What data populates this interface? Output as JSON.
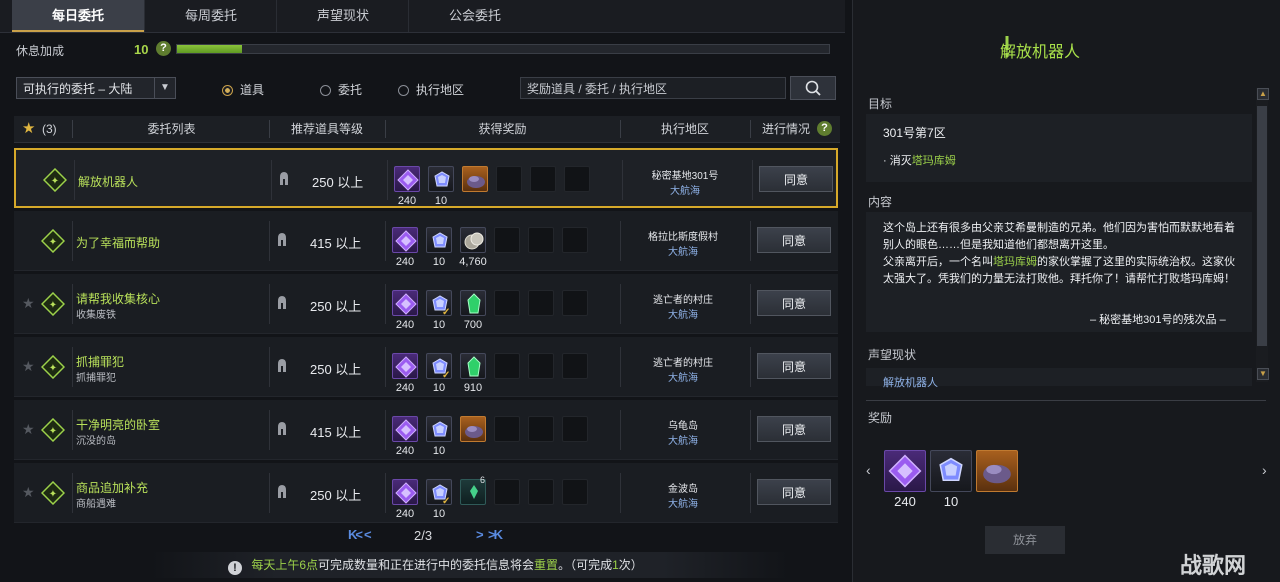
{
  "tabs": [
    {
      "label": "每日委托",
      "active": true
    },
    {
      "label": "每周委托",
      "active": false
    },
    {
      "label": "声望现状",
      "active": false
    },
    {
      "label": "公会委托",
      "active": false
    }
  ],
  "rest": {
    "label": "休息加成",
    "value": "10",
    "help": "?",
    "fill_fraction": 0.1
  },
  "filter": {
    "select_value": "可执行的委托 – 大陆",
    "radios": [
      {
        "label": "道具",
        "checked": true
      },
      {
        "label": "委托",
        "checked": false
      },
      {
        "label": "执行地区",
        "checked": false
      }
    ],
    "search_placeholder": "奖励道具 / 委托 / 执行地区"
  },
  "table": {
    "fav_count": "(3)",
    "headers": {
      "list": "委托列表",
      "level": "推荐道具等级",
      "reward": "获得奖励",
      "region": "执行地区",
      "progress": "进行情况"
    },
    "help": "?",
    "rows": [
      {
        "title": "解放机器人",
        "subtitle": "",
        "level": "250 以上",
        "selected": true,
        "starred": false,
        "rewards": [
          {
            "kind": "purple",
            "value": "240"
          },
          {
            "kind": "dark",
            "value": "10"
          },
          {
            "kind": "orange",
            "value": ""
          }
        ],
        "loc1": "秘密基地301号",
        "loc2": "大航海",
        "button": "同意"
      },
      {
        "title": "为了幸福而帮助",
        "subtitle": "",
        "level": "415 以上",
        "selected": false,
        "starred": false,
        "rewards": [
          {
            "kind": "purple",
            "value": "240"
          },
          {
            "kind": "dark",
            "value": "10"
          },
          {
            "kind": "coin",
            "value": "4,760"
          }
        ],
        "loc1": "格拉比斯度假村",
        "loc2": "大航海",
        "button": "同意"
      },
      {
        "title": "请帮我收集核心",
        "subtitle": "收集废铁",
        "level": "250 以上",
        "selected": false,
        "starred": true,
        "rewards": [
          {
            "kind": "purple",
            "value": "240"
          },
          {
            "kind": "dark-check",
            "value": "10"
          },
          {
            "kind": "green",
            "value": "700"
          }
        ],
        "loc1": "逃亡者的村庄",
        "loc2": "大航海",
        "button": "同意"
      },
      {
        "title": "抓捕罪犯",
        "subtitle": "抓捕罪犯",
        "level": "250 以上",
        "selected": false,
        "starred": true,
        "rewards": [
          {
            "kind": "purple",
            "value": "240"
          },
          {
            "kind": "dark-check",
            "value": "10"
          },
          {
            "kind": "green",
            "value": "910"
          }
        ],
        "loc1": "逃亡者的村庄",
        "loc2": "大航海",
        "button": "同意"
      },
      {
        "title": "干净明亮的卧室",
        "subtitle": "沉没的岛",
        "level": "415 以上",
        "selected": false,
        "starred": true,
        "rewards": [
          {
            "kind": "purple",
            "value": "240"
          },
          {
            "kind": "dark",
            "value": "10"
          },
          {
            "kind": "orange",
            "value": ""
          }
        ],
        "loc1": "乌龟岛",
        "loc2": "大航海",
        "button": "同意"
      },
      {
        "title": "商品追加补充",
        "subtitle": "商船遇难",
        "level": "250 以上",
        "selected": false,
        "starred": true,
        "rewards": [
          {
            "kind": "purple",
            "value": "240"
          },
          {
            "kind": "dark-check",
            "value": "10"
          },
          {
            "kind": "teal",
            "value": "6"
          }
        ],
        "loc1": "金波岛",
        "loc2": "大航海",
        "button": "同意"
      }
    ]
  },
  "pager": {
    "text": "2/3",
    "first": "K<",
    "prev": "<",
    "next": ">",
    "last": ">K"
  },
  "notice": {
    "icon": "!",
    "part1": "每天上午6点",
    "part2": "可完成数量和正在进行中的委托信息将会",
    "part3": "重置",
    "part4": "。（可完成",
    "part5": "1",
    "part6": "次）"
  },
  "detail": {
    "title": "解放机器人",
    "goal_label": "目标",
    "goal_area": "301号第7区",
    "goal_item_prefix": "· 消灭",
    "goal_item_target": "塔玛库姆",
    "content_label": "内容",
    "content_line1": "这个岛上还有很多由父亲艾希曼制造的兄弟。他们因为害怕而默默地看着别人的眼色……但是我知道他们都想离开这里。",
    "content_line2a": "父亲离开后，一个名叫",
    "content_line2b": "塔玛库姆",
    "content_line2c": "的家伙掌握了这里的实际统治权。这家伙太强大了。凭我们的力量无法打败他。拜托你了！请帮忙打败塔玛库姆！",
    "signature": "– 秘密基地301号的残次品 –",
    "rep_label": "声望现状",
    "rep_value": "解放机器人",
    "reward_label": "奖励",
    "rewards": [
      {
        "kind": "purple",
        "value": "240"
      },
      {
        "kind": "dark",
        "value": "10"
      },
      {
        "kind": "orange",
        "value": ""
      }
    ],
    "abandon": "放弃"
  },
  "watermark": "战歌网",
  "colors": {
    "accent_green": "#9cd14a",
    "accent_gold": "#d6a92a",
    "link_blue": "#8fb2e8"
  }
}
